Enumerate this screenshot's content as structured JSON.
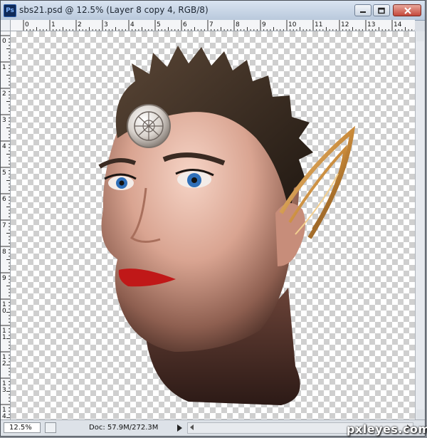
{
  "window": {
    "app_icon": "Ps",
    "title": "sbs21.psd @ 12.5% (Layer 8 copy 4, RGB/8)",
    "buttons": [
      "minimize-icon",
      "maximize-icon",
      "close-icon"
    ]
  },
  "rulers": {
    "horizontal_labels": [
      "0",
      "1",
      "2",
      "3",
      "4",
      "5",
      "6",
      "7",
      "8",
      "9",
      "10",
      "11",
      "12",
      "13",
      "14"
    ],
    "vertical_labels": [
      "0",
      "1",
      "2",
      "3",
      "4",
      "5",
      "6",
      "7",
      "8",
      "9",
      "10",
      "11",
      "12",
      "13",
      "14"
    ]
  },
  "status": {
    "zoom": "12.5%",
    "doc": "Doc: 57.9M/272.3M"
  },
  "watermark": "pxleyes.com"
}
